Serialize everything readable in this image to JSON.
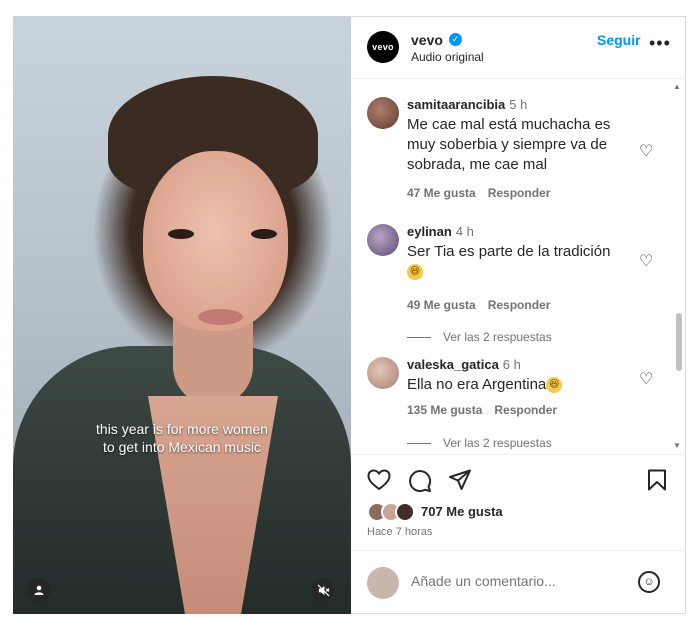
{
  "video": {
    "caption_line1": "this year is for more women",
    "caption_line2": "to get into Mexican music",
    "user_icon": "user-icon",
    "mute_icon": "muted-speaker-icon"
  },
  "header": {
    "avatar_text": "vevo",
    "username": "vevo",
    "verified_icon": "verified-badge-icon",
    "audio_label": "Audio original",
    "follow_label": "Seguir",
    "more_icon": "•••"
  },
  "comments": [
    {
      "user": "samitaarancibia",
      "time": "5 h",
      "text": "Me cae mal está muchacha es muy soberbia y siempre va de sobrada, me cae mal",
      "likes": "47 Me gusta",
      "reply": "Responder"
    },
    {
      "user": "eylinan",
      "time": "4 h",
      "text": "Ser Tia es parte de la tradición",
      "emoji": "😆",
      "likes": "49 Me gusta",
      "reply": "Responder",
      "view_replies": "Ver las 2 respuestas"
    },
    {
      "user": "valeska_gatica",
      "time": "6 h",
      "text": "Ella no era Argentina",
      "emoji": "😆",
      "likes": "135 Me gusta",
      "reply": "Responder",
      "view_replies": "Ver las 2 respuestas"
    }
  ],
  "actions": {
    "like_icon": "heart-icon",
    "comment_icon": "comment-icon",
    "share_icon": "send-icon",
    "save_icon": "bookmark-icon"
  },
  "likes": {
    "count_text": "707 Me gusta",
    "time_ago": "Hace 7 horas"
  },
  "add_comment": {
    "placeholder": "Añade un comentario...",
    "emoji_icon": "emoji-icon"
  },
  "colors": {
    "link_blue": "#0095f6",
    "text": "#262626",
    "muted": "#737373"
  }
}
